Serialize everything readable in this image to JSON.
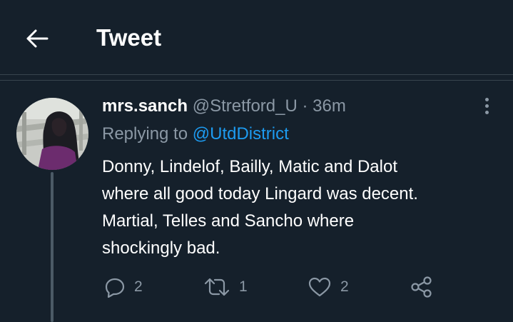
{
  "header": {
    "title": "Tweet"
  },
  "tweet": {
    "display_name": "mrs.sanch",
    "handle": "@Stretford_U",
    "separator": "·",
    "time": "36m",
    "replying_prefix": "Replying to",
    "replying_to": "@UtdDistrict",
    "text_lines": [
      "Donny, Lindelof, Bailly, Matic and Dalot",
      "where all good today Lingard was decent.",
      "Martial, Telles and Sancho where",
      "shockingly bad."
    ],
    "actions": {
      "replies": "2",
      "retweets": "1",
      "likes": "2"
    }
  },
  "icons": {
    "back": "arrow-left-icon",
    "more": "more-vertical-icon",
    "reply": "comment-icon",
    "retweet": "retweet-icon",
    "like": "heart-icon",
    "share": "share-icon"
  },
  "colors": {
    "background": "#15202b",
    "border": "#38444d",
    "secondary_text": "#8b98a5",
    "link": "#1d9bf0"
  }
}
